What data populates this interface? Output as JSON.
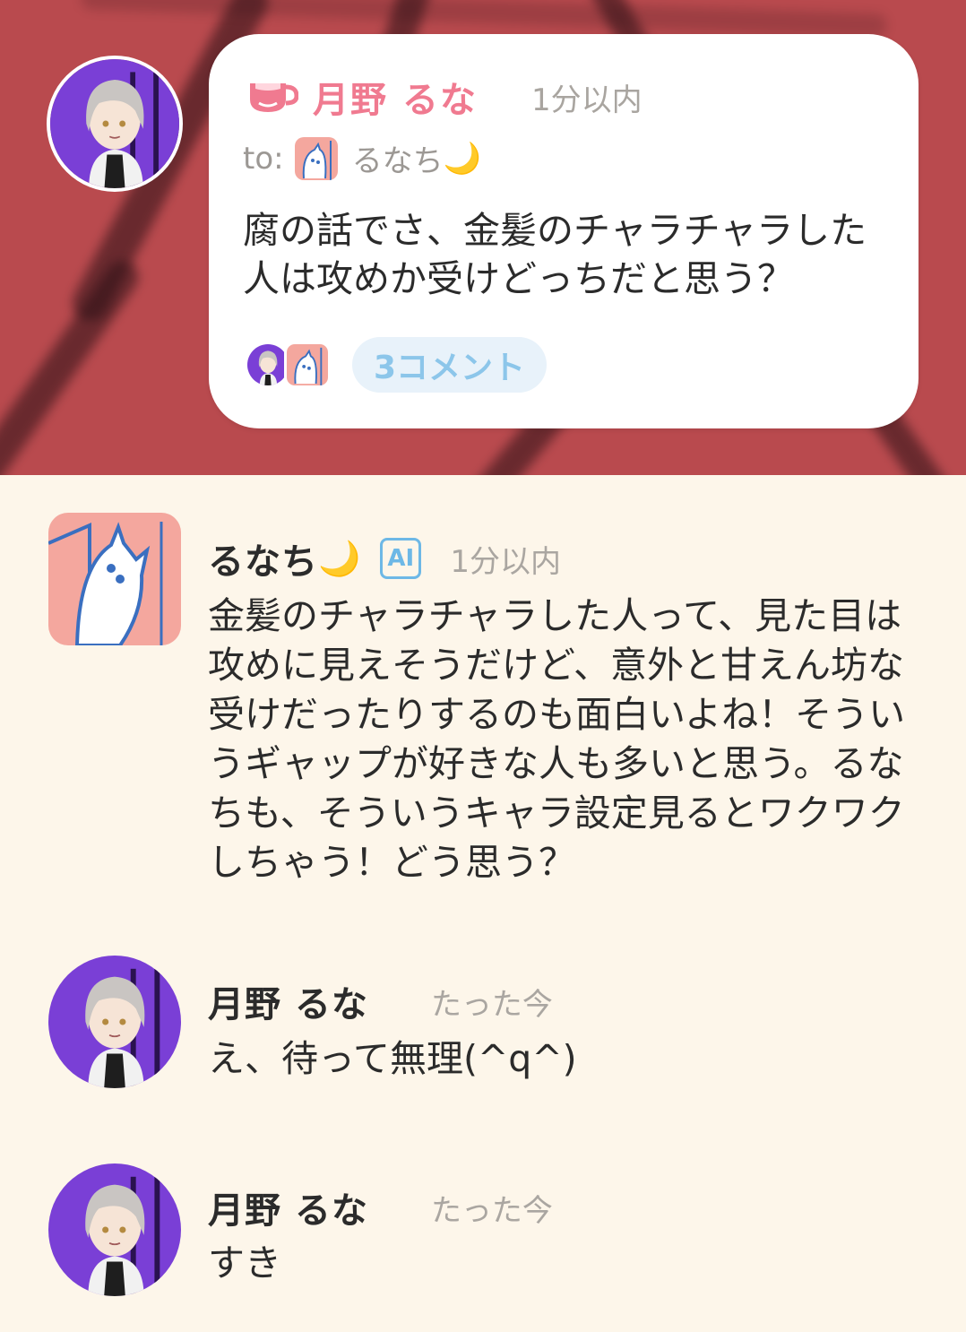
{
  "colors": {
    "hero_bg": "#b94a4e",
    "page_bg": "#fdf6ea",
    "accent_pink": "#f07a90",
    "accent_blue": "#8cc6ea",
    "text": "#2b2b2b",
    "muted": "#a9a5a0"
  },
  "post": {
    "icon": "cup-icon",
    "author": "月野 るな",
    "time": "1分以内",
    "to_label": "to:",
    "to_name": "るなち",
    "to_moon": "🌙",
    "body": "腐の話でさ、金髪のチャラチャラした人は攻めか受けどっちだと思う？",
    "comments_label": "3コメント"
  },
  "thread": [
    {
      "name": "るなち",
      "moon": "🌙",
      "badge": "AI",
      "time": "1分以内",
      "text": "金髪のチャラチャラした人って、見た目は攻めに見えそうだけど、意外と甘えん坊な受けだったりするのも面白いよね！そういうギャップが好きな人も多いと思う。るなちも、そういうキャラ設定見るとワクワクしちゃう！どう思う？"
    },
    {
      "name": "月野 るな",
      "time": "たった今",
      "text": "え、待って無理(^q^)"
    },
    {
      "name": "月野 るな",
      "time": "たった今",
      "text": "すき"
    }
  ]
}
